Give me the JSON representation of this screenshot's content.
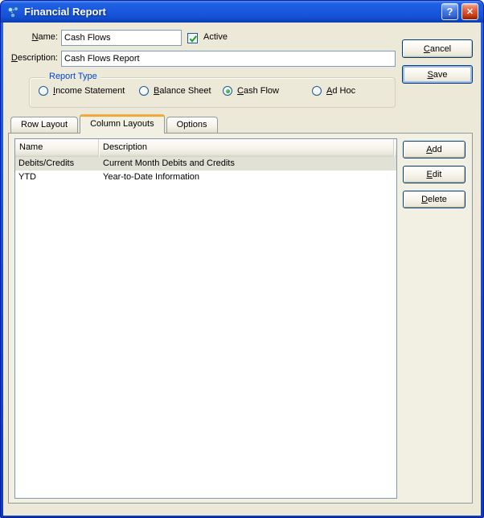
{
  "colors": {
    "titlebar_blue": "#1a5ae0",
    "dialog_background": "#ece9d8",
    "tab_active_stripe": "#ef9d2a",
    "selected_row_background": "#e2e1d5",
    "checkbox_check_green": "#23a32c",
    "radio_dot_green": "#2a9b2a",
    "groupbox_label_blue": "#0046d5",
    "close_button_red": "#cf3d15"
  },
  "window": {
    "title": "Financial Report",
    "help_glyph": "?",
    "close_glyph": "✕"
  },
  "form": {
    "name_label": {
      "key": "N",
      "rest": "ame:"
    },
    "name_value": "Cash Flows",
    "active_label": "Active",
    "active_checked": true,
    "description_label": {
      "key": "D",
      "rest": "escription:"
    },
    "description_value": "Cash Flows Report",
    "report_type": {
      "legend": "Report Type",
      "options": [
        {
          "key": "I",
          "rest": "ncome Statement",
          "selected": false
        },
        {
          "key": "B",
          "rest": "alance Sheet",
          "selected": false
        },
        {
          "key": "C",
          "rest": "ash Flow",
          "selected": true
        },
        {
          "key": "A",
          "rest": "d Hoc",
          "selected": false
        }
      ]
    }
  },
  "actions": {
    "cancel": {
      "key": "C",
      "rest": "ancel"
    },
    "save": {
      "key": "S",
      "rest": "ave"
    }
  },
  "tabs": [
    {
      "label": "Row Layout",
      "active": false
    },
    {
      "label": "Column Layouts",
      "active": true
    },
    {
      "label": "Options",
      "active": false
    }
  ],
  "list": {
    "columns": [
      "Name",
      "Description"
    ],
    "rows": [
      {
        "name": "Debits/Credits",
        "description": "Current Month Debits and Credits",
        "selected": true
      },
      {
        "name": "YTD",
        "description": "Year-to-Date Information",
        "selected": false
      }
    ]
  },
  "list_buttons": {
    "add": {
      "key": "A",
      "rest": "dd"
    },
    "edit": {
      "key": "E",
      "rest": "dit"
    },
    "delete": {
      "key": "D",
      "rest": "elete"
    }
  }
}
